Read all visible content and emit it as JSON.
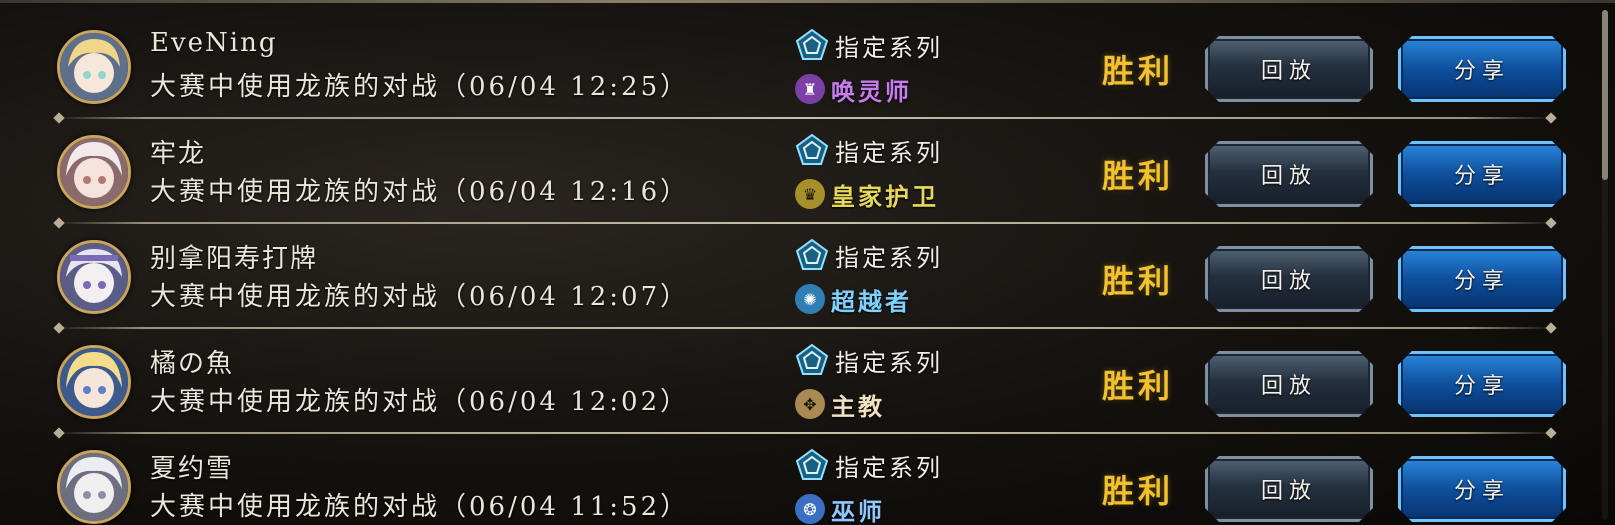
{
  "mode_label": "指定系列",
  "result_label": "胜利",
  "replay_label": "回放",
  "share_label": "分享",
  "battles": [
    {
      "player_name": "EveNing",
      "description": "大赛中使用龙族的对战（06/04 12:25）",
      "class_name": "唤灵师",
      "class_color": "#c77df0",
      "class_icon_bg": "#7b3fa6",
      "class_icon_glyph": "♜",
      "avatar_colors": [
        "#f1d58a",
        "#8fd6d0"
      ]
    },
    {
      "player_name": "牢龙",
      "description": "大赛中使用龙族的对战（06/04 12:16）",
      "class_name": "皇家护卫",
      "class_color": "#e8d85a",
      "class_icon_bg": "#a7902a",
      "class_icon_glyph": "♛",
      "avatar_colors": [
        "#f3e9ea",
        "#b07a72"
      ]
    },
    {
      "player_name": "别拿阳寿打牌",
      "description": "大赛中使用龙族的对战（06/04 12:07）",
      "class_name": "超越者",
      "class_color": "#7fd2ff",
      "class_icon_bg": "#2f7fb5",
      "class_icon_glyph": "✺",
      "avatar_colors": [
        "#e7e5f2",
        "#7b6ab5"
      ]
    },
    {
      "player_name": "橘の魚",
      "description": "大赛中使用龙族的对战（06/04 12:02）",
      "class_name": "主教",
      "class_color": "#f1e2c2",
      "class_icon_bg": "#a88a52",
      "class_icon_glyph": "✥",
      "avatar_colors": [
        "#f3dc8a",
        "#5d7fc7"
      ]
    },
    {
      "player_name": "夏约雪",
      "description": "大赛中使用龙族的对战（06/04 11:52）",
      "class_name": "巫师",
      "class_color": "#8fc8ff",
      "class_icon_bg": "#3a6fc4",
      "class_icon_glyph": "❂",
      "avatar_colors": [
        "#ecedf3",
        "#8e8fa6"
      ]
    }
  ]
}
